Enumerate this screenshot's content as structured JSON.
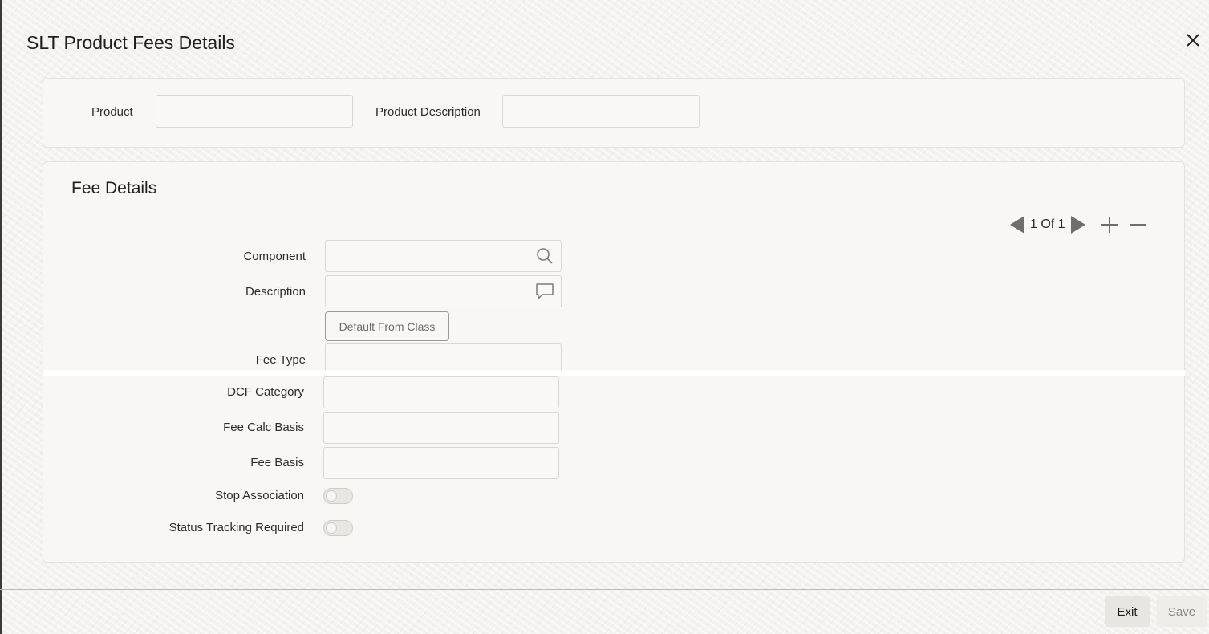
{
  "window": {
    "title": "SLT Product Fees Details",
    "close_icon": "close-icon"
  },
  "header_panel": {
    "product_label": "Product",
    "product_value": "",
    "product_description_label": "Product Description",
    "product_description_value": ""
  },
  "fee_details": {
    "section_title": "Fee Details",
    "pager": {
      "text": "1 Of 1",
      "prev_icon": "prev-triangle-icon",
      "next_icon": "next-triangle-icon",
      "add_icon": "plus-icon",
      "remove_icon": "minus-icon"
    },
    "component_label": "Component",
    "component_value": "",
    "description_label": "Description",
    "description_value": "",
    "default_from_class_label": "Default From Class",
    "fee_type_label": "Fee Type",
    "fee_type_value": "",
    "dcf_category_label": "DCF Category",
    "dcf_category_value": "",
    "fee_calc_basis_label": "Fee Calc Basis",
    "fee_calc_basis_value": "",
    "fee_basis_label": "Fee Basis",
    "fee_basis_value": "",
    "stop_association_label": "Stop Association",
    "stop_association_on": false,
    "status_tracking_label": "Status Tracking Required",
    "status_tracking_on": false
  },
  "footer": {
    "exit_label": "Exit",
    "save_label": "Save"
  }
}
